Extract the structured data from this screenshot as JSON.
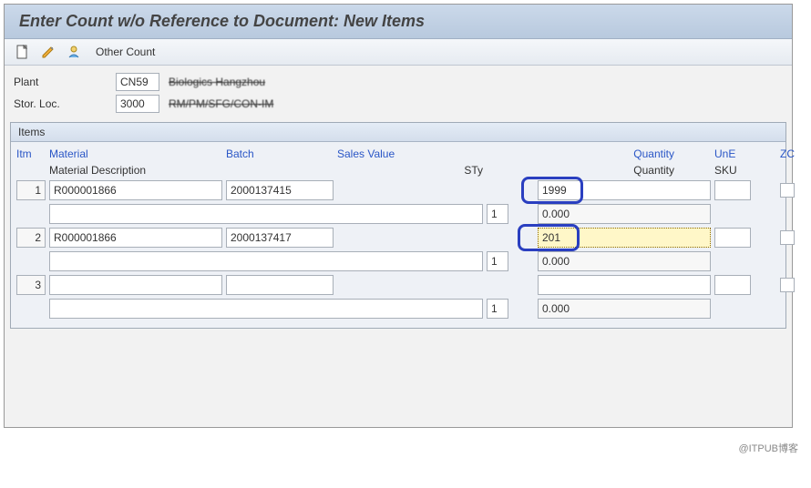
{
  "header": {
    "title": "Enter Count w/o Reference to Document: New Items"
  },
  "toolbar": {
    "other_count": "Other Count"
  },
  "form": {
    "plant_label": "Plant",
    "plant_code": "CN59",
    "plant_desc": "Biologics Hangzhou",
    "stor_label": "Stor. Loc.",
    "stor_code": "3000",
    "stor_desc": "RM/PM/SFG/CON-IM"
  },
  "items": {
    "panel_title": "Items",
    "columns": {
      "itm": "Itm",
      "material": "Material",
      "batch": "Batch",
      "sales_value": "Sales Value",
      "quantity": "Quantity",
      "une": "UnE",
      "zc": "ZC",
      "material_desc": "Material Description",
      "sty": "STy",
      "quantity_sub": "Quantity",
      "sku": "SKU"
    },
    "rows": [
      {
        "itm": "1",
        "material": "R000001866",
        "batch": "2000137415",
        "quantity": "1999",
        "sty": "1",
        "qty_sub": "0.000"
      },
      {
        "itm": "2",
        "material": "R000001866",
        "batch": "2000137417",
        "quantity": "201",
        "sty": "1",
        "qty_sub": "0.000"
      },
      {
        "itm": "3",
        "material": "",
        "batch": "",
        "quantity": "",
        "sty": "1",
        "qty_sub": "0.000"
      }
    ]
  },
  "watermark": "@ITPUB博客"
}
